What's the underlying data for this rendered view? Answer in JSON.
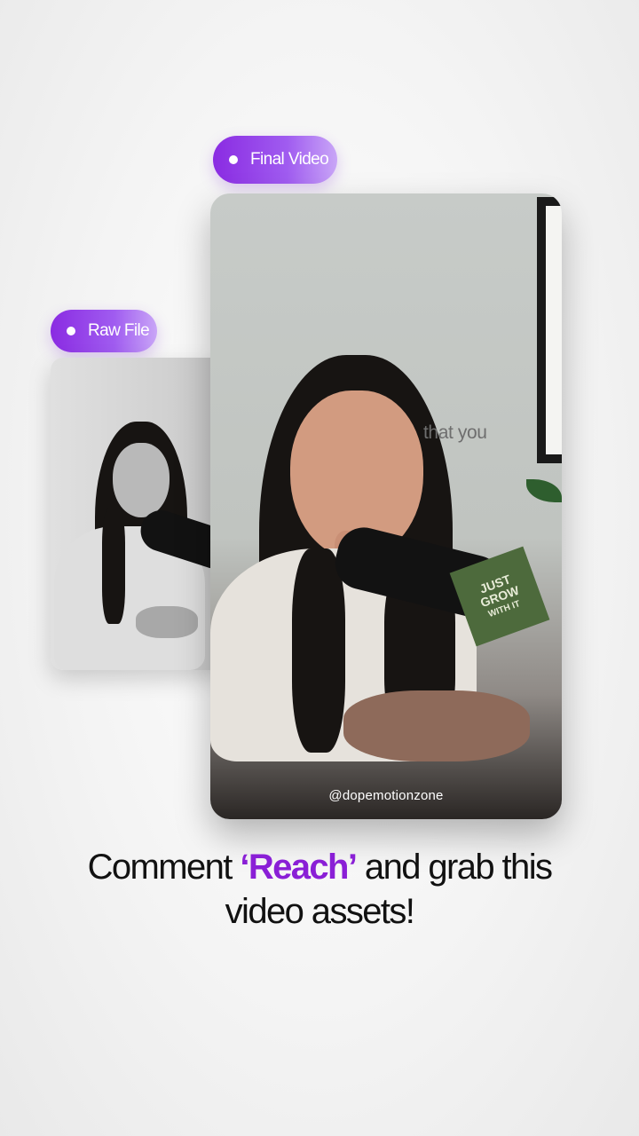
{
  "labels": {
    "final_video": "Final Video",
    "raw_file": "Raw File"
  },
  "video": {
    "caption_word": "that you",
    "watermark": "@dopemotionzone",
    "cube_lines": [
      "JUST",
      "GROW",
      "WITH IT"
    ]
  },
  "headline": {
    "part1": "Comment ",
    "accent": "‘Reach’",
    "part2": " and grab this",
    "line2": "video assets!"
  },
  "colors": {
    "accent": "#8a1fd6",
    "pill_gradient_start": "#8a2be2",
    "pill_gradient_end": "#c9a6f7"
  },
  "icons": [
    "dot-icon",
    "microphone-illustration",
    "cube-illustration"
  ]
}
